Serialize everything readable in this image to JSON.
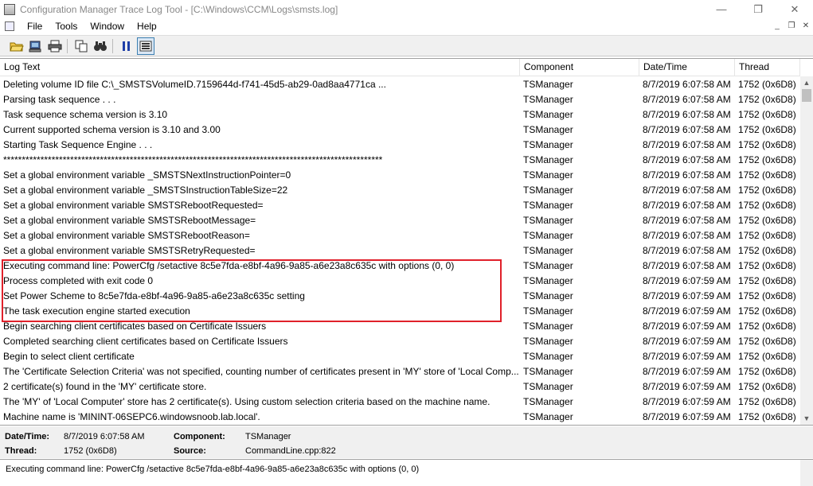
{
  "window": {
    "title": "Configuration Manager Trace Log Tool - [C:\\Windows\\CCM\\Logs\\smsts.log]"
  },
  "menu": {
    "items": [
      "File",
      "Tools",
      "Window",
      "Help"
    ]
  },
  "toolbar": {
    "buttons": [
      "open-icon",
      "open-remote-icon",
      "print-icon",
      "copy-icon",
      "find-icon",
      "pause-icon",
      "highlight-icon"
    ]
  },
  "columns": [
    "Log Text",
    "Component",
    "Date/Time",
    "Thread"
  ],
  "rows": [
    {
      "text": "Deleting volume ID file C:\\_SMSTSVolumeID.7159644d-f741-45d5-ab29-0ad8aa4771ca ...",
      "component": "TSManager",
      "datetime": "8/7/2019 6:07:58 AM",
      "thread": "1752 (0x6D8)"
    },
    {
      "text": "Parsing task sequence . . .",
      "component": "TSManager",
      "datetime": "8/7/2019 6:07:58 AM",
      "thread": "1752 (0x6D8)"
    },
    {
      "text": "Task sequence schema version is 3.10",
      "component": "TSManager",
      "datetime": "8/7/2019 6:07:58 AM",
      "thread": "1752 (0x6D8)"
    },
    {
      "text": "Current supported schema version is 3.10 and 3.00",
      "component": "TSManager",
      "datetime": "8/7/2019 6:07:58 AM",
      "thread": "1752 (0x6D8)"
    },
    {
      "text": "Starting Task Sequence Engine . . .",
      "component": "TSManager",
      "datetime": "8/7/2019 6:07:58 AM",
      "thread": "1752 (0x6D8)"
    },
    {
      "text": "******************************************************************************************************",
      "component": "TSManager",
      "datetime": "8/7/2019 6:07:58 AM",
      "thread": "1752 (0x6D8)"
    },
    {
      "text": "Set a global environment variable _SMSTSNextInstructionPointer=0",
      "component": "TSManager",
      "datetime": "8/7/2019 6:07:58 AM",
      "thread": "1752 (0x6D8)"
    },
    {
      "text": "Set a global environment variable _SMSTSInstructionTableSize=22",
      "component": "TSManager",
      "datetime": "8/7/2019 6:07:58 AM",
      "thread": "1752 (0x6D8)"
    },
    {
      "text": "Set a global environment variable SMSTSRebootRequested=",
      "component": "TSManager",
      "datetime": "8/7/2019 6:07:58 AM",
      "thread": "1752 (0x6D8)"
    },
    {
      "text": "Set a global environment variable SMSTSRebootMessage=",
      "component": "TSManager",
      "datetime": "8/7/2019 6:07:58 AM",
      "thread": "1752 (0x6D8)"
    },
    {
      "text": "Set a global environment variable SMSTSRebootReason=",
      "component": "TSManager",
      "datetime": "8/7/2019 6:07:58 AM",
      "thread": "1752 (0x6D8)"
    },
    {
      "text": "Set a global environment variable SMSTSRetryRequested=",
      "component": "TSManager",
      "datetime": "8/7/2019 6:07:58 AM",
      "thread": "1752 (0x6D8)"
    },
    {
      "text": "Executing command line: PowerCfg /setactive 8c5e7fda-e8bf-4a96-9a85-a6e23a8c635c with options (0, 0)",
      "component": "TSManager",
      "datetime": "8/7/2019 6:07:58 AM",
      "thread": "1752 (0x6D8)"
    },
    {
      "text": "Process completed with exit code 0",
      "component": "TSManager",
      "datetime": "8/7/2019 6:07:59 AM",
      "thread": "1752 (0x6D8)"
    },
    {
      "text": "Set Power Scheme to 8c5e7fda-e8bf-4a96-9a85-a6e23a8c635c setting",
      "component": "TSManager",
      "datetime": "8/7/2019 6:07:59 AM",
      "thread": "1752 (0x6D8)"
    },
    {
      "text": "The task execution engine started execution",
      "component": "TSManager",
      "datetime": "8/7/2019 6:07:59 AM",
      "thread": "1752 (0x6D8)"
    },
    {
      "text": "Begin searching client certificates based on Certificate Issuers",
      "component": "TSManager",
      "datetime": "8/7/2019 6:07:59 AM",
      "thread": "1752 (0x6D8)"
    },
    {
      "text": "Completed searching client certificates based on Certificate Issuers",
      "component": "TSManager",
      "datetime": "8/7/2019 6:07:59 AM",
      "thread": "1752 (0x6D8)"
    },
    {
      "text": "Begin to select client certificate",
      "component": "TSManager",
      "datetime": "8/7/2019 6:07:59 AM",
      "thread": "1752 (0x6D8)"
    },
    {
      "text": "The 'Certificate Selection Criteria' was not specified, counting number of certificates present in 'MY' store of 'Local Comp...",
      "component": "TSManager",
      "datetime": "8/7/2019 6:07:59 AM",
      "thread": "1752 (0x6D8)"
    },
    {
      "text": "2 certificate(s) found in the 'MY' certificate store.",
      "component": "TSManager",
      "datetime": "8/7/2019 6:07:59 AM",
      "thread": "1752 (0x6D8)"
    },
    {
      "text": "The 'MY' of 'Local Computer' store has 2 certificate(s). Using custom selection criteria based on the machine name.",
      "component": "TSManager",
      "datetime": "8/7/2019 6:07:59 AM",
      "thread": "1752 (0x6D8)"
    },
    {
      "text": "Machine name is 'MININT-06SEPC6.windowsnoob.lab.local'.",
      "component": "TSManager",
      "datetime": "8/7/2019 6:07:59 AM",
      "thread": "1752 (0x6D8)"
    }
  ],
  "details": {
    "datetime_label": "Date/Time:",
    "datetime_value": "8/7/2019 6:07:58 AM",
    "component_label": "Component:",
    "component_value": "TSManager",
    "thread_label": "Thread:",
    "thread_value": "1752 (0x6D8)",
    "source_label": "Source:",
    "source_value": "CommandLine.cpp:822"
  },
  "message": "Executing command line: PowerCfg /setactive 8c5e7fda-e8bf-4a96-9a85-a6e23a8c635c with options (0, 0)"
}
